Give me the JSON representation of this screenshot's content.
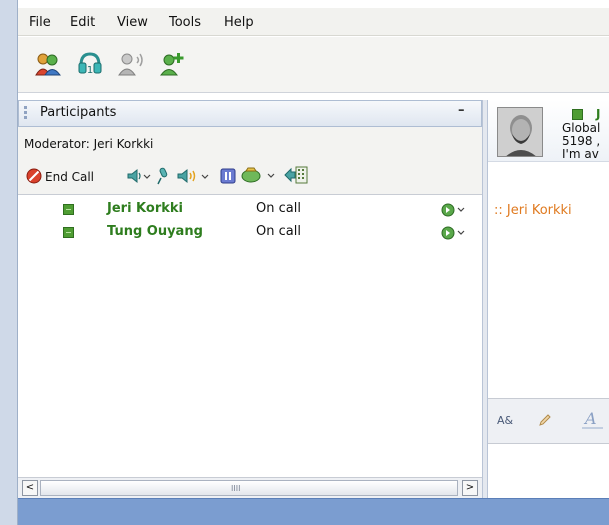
{
  "menu": {
    "items": [
      {
        "label": "File"
      },
      {
        "label": "Edit"
      },
      {
        "label": "View"
      },
      {
        "label": "Tools"
      },
      {
        "label": "Help"
      }
    ]
  },
  "toolbar": {
    "icons": [
      "contacts-icon",
      "voicemail-icon",
      "call-contact-icon",
      "add-contact-icon"
    ]
  },
  "participants": {
    "title": "Participants",
    "collapse_label": "–",
    "moderator_label": "Moderator:  Jeri Korkki",
    "end_call_label": "End Call",
    "list": [
      {
        "name": "Jeri Korkki",
        "state": "On call"
      },
      {
        "name": "Tung Ouyang",
        "state": "On call"
      }
    ]
  },
  "scrollbar": {
    "left_arrow": "<",
    "right_arrow": ">",
    "grip": "IIII"
  },
  "contact": {
    "name": "J",
    "line1": "Global",
    "line2": "5198 ,",
    "line3": "I'm av"
  },
  "chat": {
    "line": ":: Jeri Korkki"
  },
  "compose": {
    "font_label": "A&"
  },
  "colors": {
    "presence_green": "#4f9d33",
    "name_green": "#2e7d1e",
    "chat_orange": "#e07a1f",
    "status_bar": "#7b9dd0"
  }
}
